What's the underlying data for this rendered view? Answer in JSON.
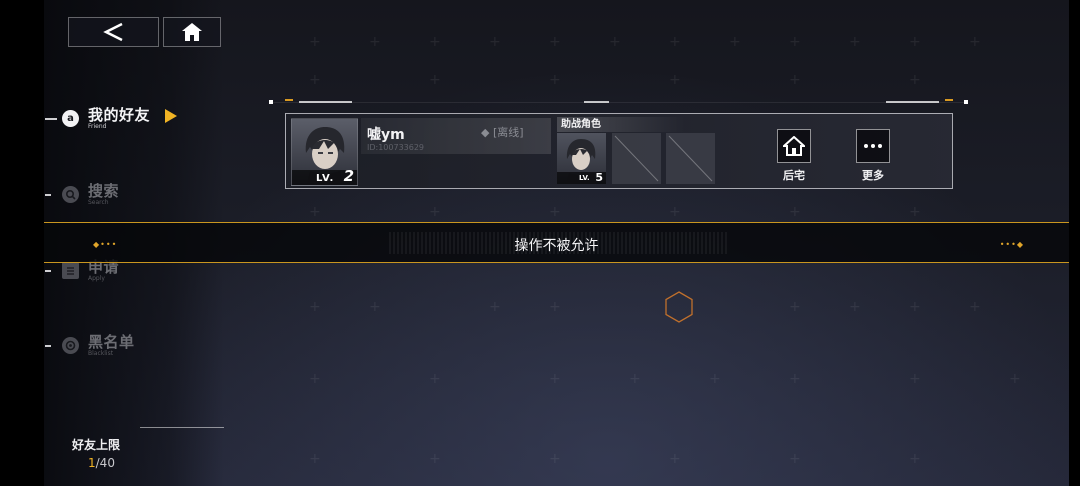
{
  "nav": {
    "items": [
      {
        "label": "我的好友",
        "sub": "Friend",
        "active": true
      },
      {
        "label": "搜索",
        "sub": "Search",
        "active": false
      },
      {
        "label": "申请",
        "sub": "Apply",
        "active": false
      },
      {
        "label": "黑名单",
        "sub": "Blacklist",
        "active": false
      }
    ]
  },
  "friend_limit": {
    "title": "好友上限",
    "current": "1",
    "max": "/40"
  },
  "friend_card": {
    "level_prefix": "LV.",
    "level": "2",
    "name": "嘘ym",
    "id": "ID:100733629",
    "status": "◆ [离线]",
    "support_title": "助战角色",
    "support_level_prefix": "LV.",
    "support_level": "5",
    "actions": {
      "home_label": "后宅",
      "more_label": "更多"
    }
  },
  "toast": {
    "message": "操作不被允许"
  },
  "colors": {
    "accent": "#f0b324",
    "toast_border": "#c9961f"
  },
  "icons": [
    "back-arrow-icon",
    "home-icon",
    "friend-icon",
    "search-icon",
    "apply-icon",
    "blacklist-icon",
    "more-icon",
    "loading-hex-icon"
  ]
}
